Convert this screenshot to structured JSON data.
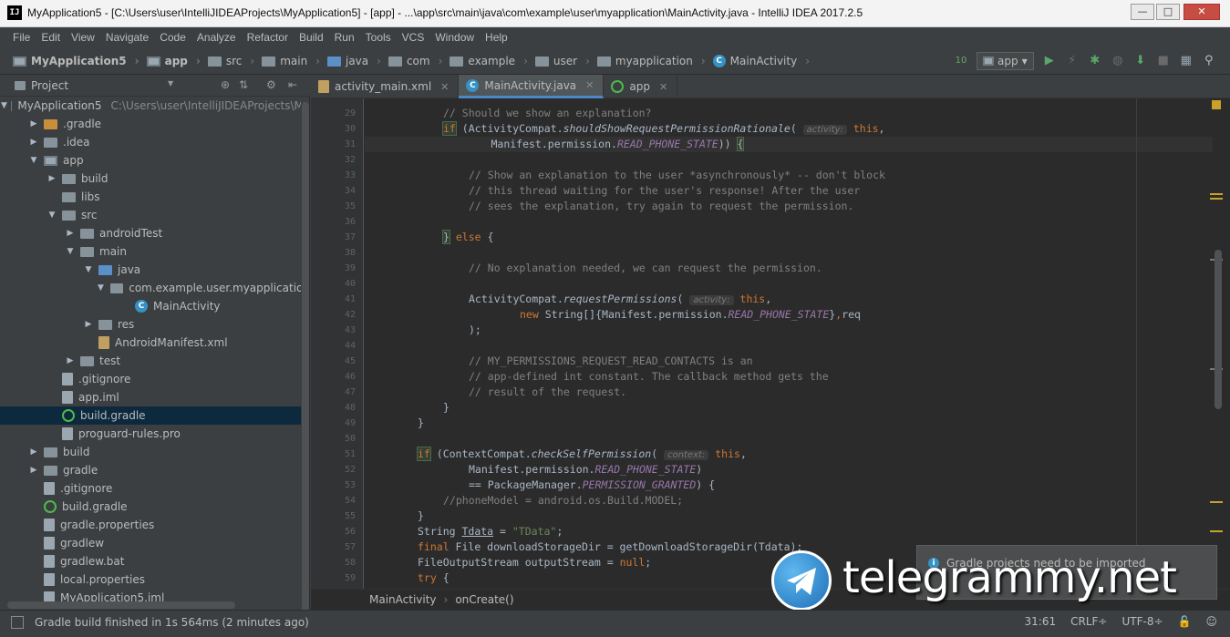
{
  "window": {
    "title": "MyApplication5 - [C:\\Users\\user\\IntelliJIDEAProjects\\MyApplication5] - [app] - ...\\app\\src\\main\\java\\com\\example\\user\\myapplication\\MainActivity.java - IntelliJ IDEA 2017.2.5",
    "app_icon": "IJ",
    "minimize": "—",
    "maximize": "□",
    "close": "✕"
  },
  "menu": [
    "File",
    "Edit",
    "View",
    "Navigate",
    "Code",
    "Analyze",
    "Refactor",
    "Build",
    "Run",
    "Tools",
    "VCS",
    "Window",
    "Help"
  ],
  "navbar": {
    "crumbs": [
      "MyApplication5",
      "app",
      "src",
      "main",
      "java",
      "com",
      "example",
      "user",
      "myapplication",
      "MainActivity"
    ],
    "run_config": "app"
  },
  "project": {
    "header": "Project",
    "tree": [
      {
        "indent": 0,
        "arrow": "▼",
        "icon": "module",
        "label": "MyApplication5",
        "path": "C:\\Users\\user\\IntelliJIDEAProjects\\My"
      },
      {
        "indent": 1,
        "arrow": "▶",
        "icon": "orange",
        "label": ".gradle"
      },
      {
        "indent": 1,
        "arrow": "▶",
        "icon": "folder",
        "label": ".idea"
      },
      {
        "indent": 1,
        "arrow": "▼",
        "icon": "module",
        "label": "app"
      },
      {
        "indent": 2,
        "arrow": "▶",
        "icon": "folder",
        "label": "build"
      },
      {
        "indent": 2,
        "arrow": "",
        "icon": "folder",
        "label": "libs"
      },
      {
        "indent": 2,
        "arrow": "▼",
        "icon": "folder",
        "label": "src"
      },
      {
        "indent": 3,
        "arrow": "▶",
        "icon": "folder",
        "label": "androidTest"
      },
      {
        "indent": 3,
        "arrow": "▼",
        "icon": "folder",
        "label": "main"
      },
      {
        "indent": 4,
        "arrow": "▼",
        "icon": "blue",
        "label": "java"
      },
      {
        "indent": 5,
        "arrow": "▼",
        "icon": "folder",
        "label": "com.example.user.myapplication"
      },
      {
        "indent": 6,
        "arrow": "",
        "icon": "class",
        "label": "MainActivity"
      },
      {
        "indent": 4,
        "arrow": "▶",
        "icon": "folder",
        "label": "res"
      },
      {
        "indent": 4,
        "arrow": "",
        "icon": "xml",
        "label": "AndroidManifest.xml"
      },
      {
        "indent": 3,
        "arrow": "▶",
        "icon": "folder",
        "label": "test"
      },
      {
        "indent": 2,
        "arrow": "",
        "icon": "file",
        "label": ".gitignore"
      },
      {
        "indent": 2,
        "arrow": "",
        "icon": "file",
        "label": "app.iml"
      },
      {
        "indent": 2,
        "arrow": "",
        "icon": "gradle",
        "label": "build.gradle",
        "selected": true
      },
      {
        "indent": 2,
        "arrow": "",
        "icon": "file",
        "label": "proguard-rules.pro"
      },
      {
        "indent": 1,
        "arrow": "▶",
        "icon": "folder",
        "label": "build"
      },
      {
        "indent": 1,
        "arrow": "▶",
        "icon": "folder",
        "label": "gradle"
      },
      {
        "indent": 1,
        "arrow": "",
        "icon": "file",
        "label": ".gitignore"
      },
      {
        "indent": 1,
        "arrow": "",
        "icon": "gradle",
        "label": "build.gradle"
      },
      {
        "indent": 1,
        "arrow": "",
        "icon": "file",
        "label": "gradle.properties"
      },
      {
        "indent": 1,
        "arrow": "",
        "icon": "file",
        "label": "gradlew"
      },
      {
        "indent": 1,
        "arrow": "",
        "icon": "file",
        "label": "gradlew.bat"
      },
      {
        "indent": 1,
        "arrow": "",
        "icon": "file",
        "label": "local.properties"
      },
      {
        "indent": 1,
        "arrow": "",
        "icon": "file",
        "label": "MyApplication5.iml"
      }
    ]
  },
  "tabs": [
    {
      "label": "activity_main.xml",
      "icon": "xml",
      "active": false
    },
    {
      "label": "MainActivity.java",
      "icon": "class",
      "active": true
    },
    {
      "label": "app",
      "icon": "gradle",
      "active": false
    }
  ],
  "editor": {
    "line_numbers": [
      "29",
      "30",
      "31",
      "32",
      "33",
      "34",
      "35",
      "36",
      "37",
      "38",
      "39",
      "40",
      "41",
      "42",
      "43",
      "44",
      "45",
      "46",
      "47",
      "48",
      "49",
      "50",
      "51",
      "52",
      "53",
      "54",
      "55",
      "56",
      "57",
      "58",
      "59"
    ],
    "caret_line_index": 2
  },
  "code_breadcrumb": [
    "MainActivity",
    "onCreate()"
  ],
  "notification": {
    "text": "Gradle projects need to be imported"
  },
  "status": {
    "message": "Gradle build finished in 1s 564ms (2 minutes ago)",
    "position": "31:61",
    "line_sep": "CRLF÷",
    "encoding": "UTF-8÷"
  },
  "watermark": {
    "text": "telegrammy.net"
  },
  "colors": {
    "accent": "#4a88c7",
    "keyword": "#cc7832",
    "comment": "#808080",
    "string": "#6a8759",
    "constant": "#9876aa"
  }
}
